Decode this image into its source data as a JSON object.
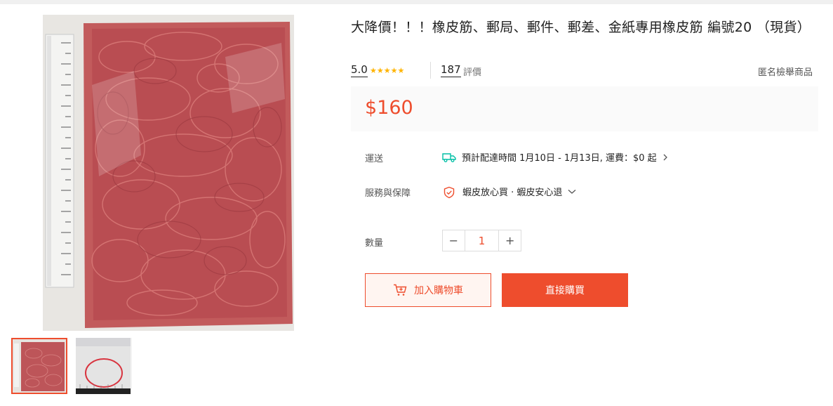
{
  "product": {
    "title": "大降價！！！橡皮筋、郵局、郵件、郵差、金紙專用橡皮筋 編號20 （現貨）",
    "rating": "5.0",
    "stars": "★★★★★",
    "review_count": "187",
    "review_label": "評價",
    "anonymous_report": "匿名檢舉商品",
    "price": "$160"
  },
  "shipping": {
    "label": "運送",
    "value": "預計配達時間 1月10日 - 1月13日, 運費：$0 起",
    "icon": "truck-icon"
  },
  "service": {
    "label": "服務與保障",
    "value": "蝦皮放心買 · 蝦皮安心退",
    "icon": "shield-check-icon"
  },
  "quantity": {
    "label": "數量",
    "value": "1",
    "minus": "−",
    "plus": "+"
  },
  "actions": {
    "add_to_cart": "加入購物車",
    "buy_now": "直接購買"
  },
  "colors": {
    "brand": "#ee4d2d",
    "star": "#ffb400"
  }
}
